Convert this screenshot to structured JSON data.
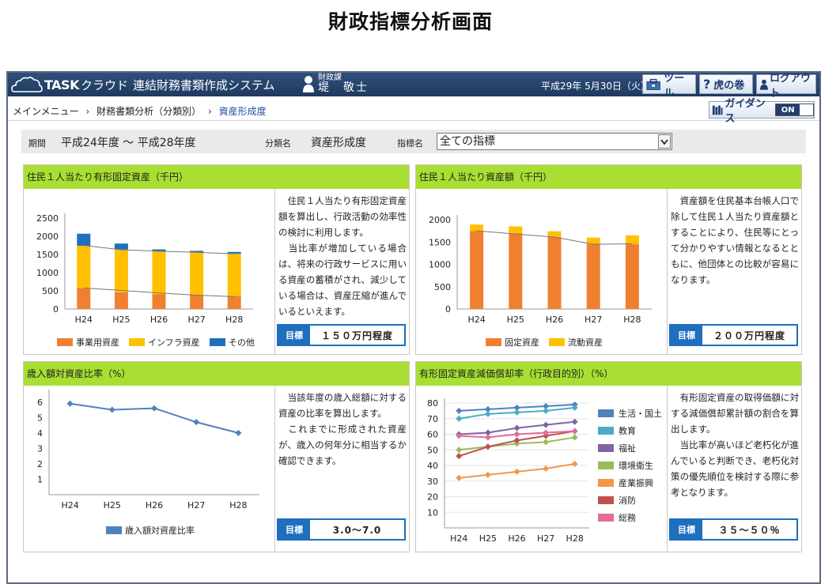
{
  "page_title": "財政指標分析画面",
  "header": {
    "logo_task": "TASK",
    "logo_cloud": "クラウド",
    "system_name": "連結財務書類作成システム",
    "user_dept": "財政課",
    "user_name": "堤　敬士",
    "date": "平成29年 5月30日（火）",
    "tool_label": "ツール",
    "help_label": "虎の巻",
    "logout_label": "ログアウト"
  },
  "breadcrumb": {
    "items": [
      "メインメニュー",
      "財務書類分析（分類別）",
      "資産形成度"
    ]
  },
  "guidance": {
    "label": "ガイダンス",
    "state": "ON"
  },
  "filter": {
    "period_label": "期間",
    "period_value": "平成24年度 ～ 平成28年度",
    "category_label": "分類名",
    "category_value": "資産形成度",
    "indicator_label": "指標名",
    "indicator_value": "全ての指標"
  },
  "panels": [
    {
      "title": "住民１人当たり有形固定資産（千円）",
      "desc": "　住民１人当たり有形固定資産額を算出し、行政活動の効率性の検討に利用します。\n　当比率が増加している場合は、将来の行政サービスに用いる資産の蓄積がされ、減少している場合は、資産圧縮が進んでいるといえます。",
      "target_label": "目標",
      "target_value": "１５０万円程度"
    },
    {
      "title": "住民１人当たり資産額（千円）",
      "desc": "　資産額を住民基本台帳人口で除して住民１人当たり資産額とすることにより、住民等にとって分かりやすい情報となるとともに、他団体との比較が容易になります。",
      "target_label": "目標",
      "target_value": "２００万円程度"
    },
    {
      "title": "歳入額対資産比率（%）",
      "desc": "　当該年度の歳入総額に対する資産の比率を算出します。\n　これまでに形成された資産が、歳入の何年分に相当するか確認できます。",
      "target_label": "目標",
      "target_value": "3.0～7.0"
    },
    {
      "title": "有形固定資産減価償却率（行政目的別）（%）",
      "desc": "　有形固定資産の取得価額に対する減価償却累計額の割合を算出します。\n　当比率が高いほど老朽化が進んでいると判断でき、老朽化対策の優先順位を検討する際に参考となります。",
      "target_label": "目標",
      "target_value": "３５～５０％"
    }
  ],
  "colors": {
    "header_bg": "#1f3a60",
    "panel_head": "#a8df32",
    "target_blue": "#1f6fbf",
    "orange": "#f08030",
    "yellow": "#ffc000",
    "blue": "#1f6fbf"
  },
  "chart_data": [
    {
      "type": "bar",
      "stacked": true,
      "categories": [
        "H24",
        "H25",
        "H26",
        "H27",
        "H28"
      ],
      "series": [
        {
          "name": "事業用資産",
          "color": "#f08030",
          "values": [
            580,
            460,
            410,
            380,
            360
          ]
        },
        {
          "name": "インフラ資産",
          "color": "#ffc000",
          "values": [
            1160,
            1180,
            1180,
            1180,
            1160
          ]
        },
        {
          "name": "その他",
          "color": "#1f6fbf",
          "values": [
            330,
            160,
            50,
            40,
            50
          ]
        }
      ],
      "lines": [
        {
          "color": "#777777",
          "values": [
            1750,
            1630,
            1590,
            1560,
            1520
          ]
        },
        {
          "color": "#777777",
          "values": [
            580,
            510,
            440,
            380,
            340
          ]
        }
      ],
      "ylim": [
        0,
        2500
      ],
      "yticks": [
        0,
        500,
        1000,
        1500,
        2000,
        2500
      ]
    },
    {
      "type": "bar",
      "stacked": true,
      "categories": [
        "H24",
        "H25",
        "H26",
        "H27",
        "H28"
      ],
      "series": [
        {
          "name": "固定資産",
          "color": "#f08030",
          "values": [
            1750,
            1690,
            1610,
            1450,
            1450
          ]
        },
        {
          "name": "流動資産",
          "color": "#ffc000",
          "values": [
            140,
            160,
            130,
            150,
            200
          ]
        }
      ],
      "lines": [
        {
          "color": "#777777",
          "values": [
            1750,
            1680,
            1610,
            1450,
            1460
          ]
        }
      ],
      "ylim": [
        0,
        2000
      ],
      "yticks": [
        0,
        500,
        1000,
        1500,
        2000
      ]
    },
    {
      "type": "line",
      "categories": [
        "H24",
        "H25",
        "H26",
        "H27",
        "H28"
      ],
      "series": [
        {
          "name": "歳入額対資産比率",
          "color": "#4f81bd",
          "values": [
            5.9,
            5.5,
            5.6,
            4.7,
            4.0
          ]
        }
      ],
      "ylim": [
        0,
        6.5
      ],
      "yticks": [
        1,
        2,
        3,
        4,
        5,
        6
      ]
    },
    {
      "type": "line",
      "categories": [
        "H24",
        "H25",
        "H26",
        "H27",
        "H28"
      ],
      "series": [
        {
          "name": "生活・国土",
          "color": "#4f81bd",
          "values": [
            75,
            76,
            77,
            78,
            79
          ]
        },
        {
          "name": "教育",
          "color": "#4bacc6",
          "values": [
            70,
            73,
            74,
            75,
            77
          ]
        },
        {
          "name": "福祉",
          "color": "#8064a2",
          "values": [
            60,
            61,
            64,
            66,
            68
          ]
        },
        {
          "name": "環境衛生",
          "color": "#9bbb59",
          "values": [
            50,
            52,
            54,
            55,
            58
          ]
        },
        {
          "name": "産業振興",
          "color": "#f79646",
          "values": [
            32,
            34,
            36,
            38,
            41
          ]
        },
        {
          "name": "消防",
          "color": "#c0504d",
          "values": [
            46,
            52,
            56,
            59,
            62
          ]
        },
        {
          "name": "総務",
          "color": "#e36c9a",
          "values": [
            59,
            58,
            60,
            61,
            62
          ]
        }
      ],
      "ylim": [
        0,
        80
      ],
      "yticks": [
        10,
        20,
        30,
        40,
        50,
        60,
        70,
        80
      ]
    }
  ]
}
